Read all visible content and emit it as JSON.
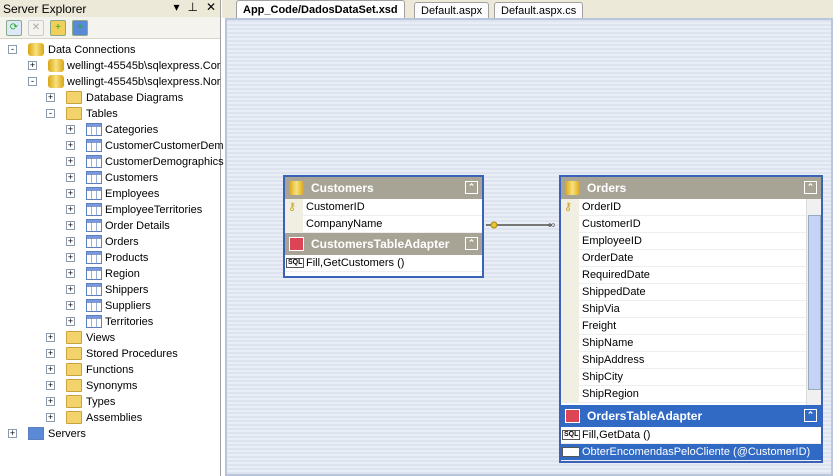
{
  "server_explorer": {
    "title": "Server Explorer",
    "buttons": [
      "▾",
      "⊥",
      "✕"
    ],
    "tree": [
      {
        "label": "Data Connections",
        "level": 0,
        "exp": "-",
        "icon": "db"
      },
      {
        "label": "wellingt-45545b\\sqlexpress.Cor",
        "level": 1,
        "exp": "+",
        "icon": "db"
      },
      {
        "label": "wellingt-45545b\\sqlexpress.Nor",
        "level": 1,
        "exp": "-",
        "icon": "db"
      },
      {
        "label": "Database Diagrams",
        "level": 2,
        "exp": "+",
        "icon": "folder"
      },
      {
        "label": "Tables",
        "level": 2,
        "exp": "-",
        "icon": "folder"
      },
      {
        "label": "Categories",
        "level": 3,
        "exp": "+",
        "icon": "tbl"
      },
      {
        "label": "CustomerCustomerDem",
        "level": 3,
        "exp": "+",
        "icon": "tbl"
      },
      {
        "label": "CustomerDemographics",
        "level": 3,
        "exp": "+",
        "icon": "tbl"
      },
      {
        "label": "Customers",
        "level": 3,
        "exp": "+",
        "icon": "tbl"
      },
      {
        "label": "Employees",
        "level": 3,
        "exp": "+",
        "icon": "tbl"
      },
      {
        "label": "EmployeeTerritories",
        "level": 3,
        "exp": "+",
        "icon": "tbl"
      },
      {
        "label": "Order Details",
        "level": 3,
        "exp": "+",
        "icon": "tbl"
      },
      {
        "label": "Orders",
        "level": 3,
        "exp": "+",
        "icon": "tbl"
      },
      {
        "label": "Products",
        "level": 3,
        "exp": "+",
        "icon": "tbl"
      },
      {
        "label": "Region",
        "level": 3,
        "exp": "+",
        "icon": "tbl"
      },
      {
        "label": "Shippers",
        "level": 3,
        "exp": "+",
        "icon": "tbl"
      },
      {
        "label": "Suppliers",
        "level": 3,
        "exp": "+",
        "icon": "tbl"
      },
      {
        "label": "Territories",
        "level": 3,
        "exp": "+",
        "icon": "tbl"
      },
      {
        "label": "Views",
        "level": 2,
        "exp": "+",
        "icon": "folder"
      },
      {
        "label": "Stored Procedures",
        "level": 2,
        "exp": "+",
        "icon": "folder"
      },
      {
        "label": "Functions",
        "level": 2,
        "exp": "+",
        "icon": "folder"
      },
      {
        "label": "Synonyms",
        "level": 2,
        "exp": "+",
        "icon": "folder"
      },
      {
        "label": "Types",
        "level": 2,
        "exp": "+",
        "icon": "folder"
      },
      {
        "label": "Assemblies",
        "level": 2,
        "exp": "+",
        "icon": "folder"
      },
      {
        "label": "Servers",
        "level": 0,
        "exp": "+",
        "icon": "server"
      }
    ]
  },
  "tabs": [
    "App_Code/DadosDataSet.xsd",
    "Default.aspx",
    "Default.aspx.cs"
  ],
  "customers": {
    "title": "Customers",
    "columns": [
      "CustomerID",
      "CompanyName"
    ],
    "adapter": "CustomersTableAdapter",
    "queries": [
      "Fill,GetCustomers ()"
    ]
  },
  "orders": {
    "title": "Orders",
    "columns": [
      "OrderID",
      "CustomerID",
      "EmployeeID",
      "OrderDate",
      "RequiredDate",
      "ShippedDate",
      "ShipVia",
      "Freight",
      "ShipName",
      "ShipAddress",
      "ShipCity",
      "ShipRegion"
    ],
    "adapter": "OrdersTableAdapter",
    "queries": [
      "Fill,GetData ()",
      "ObterEncomendasPeloCliente (@CustomerID)"
    ]
  },
  "colors": {
    "selection": "#316ac5",
    "header": "#a8a495",
    "border": "#3a62b8"
  }
}
